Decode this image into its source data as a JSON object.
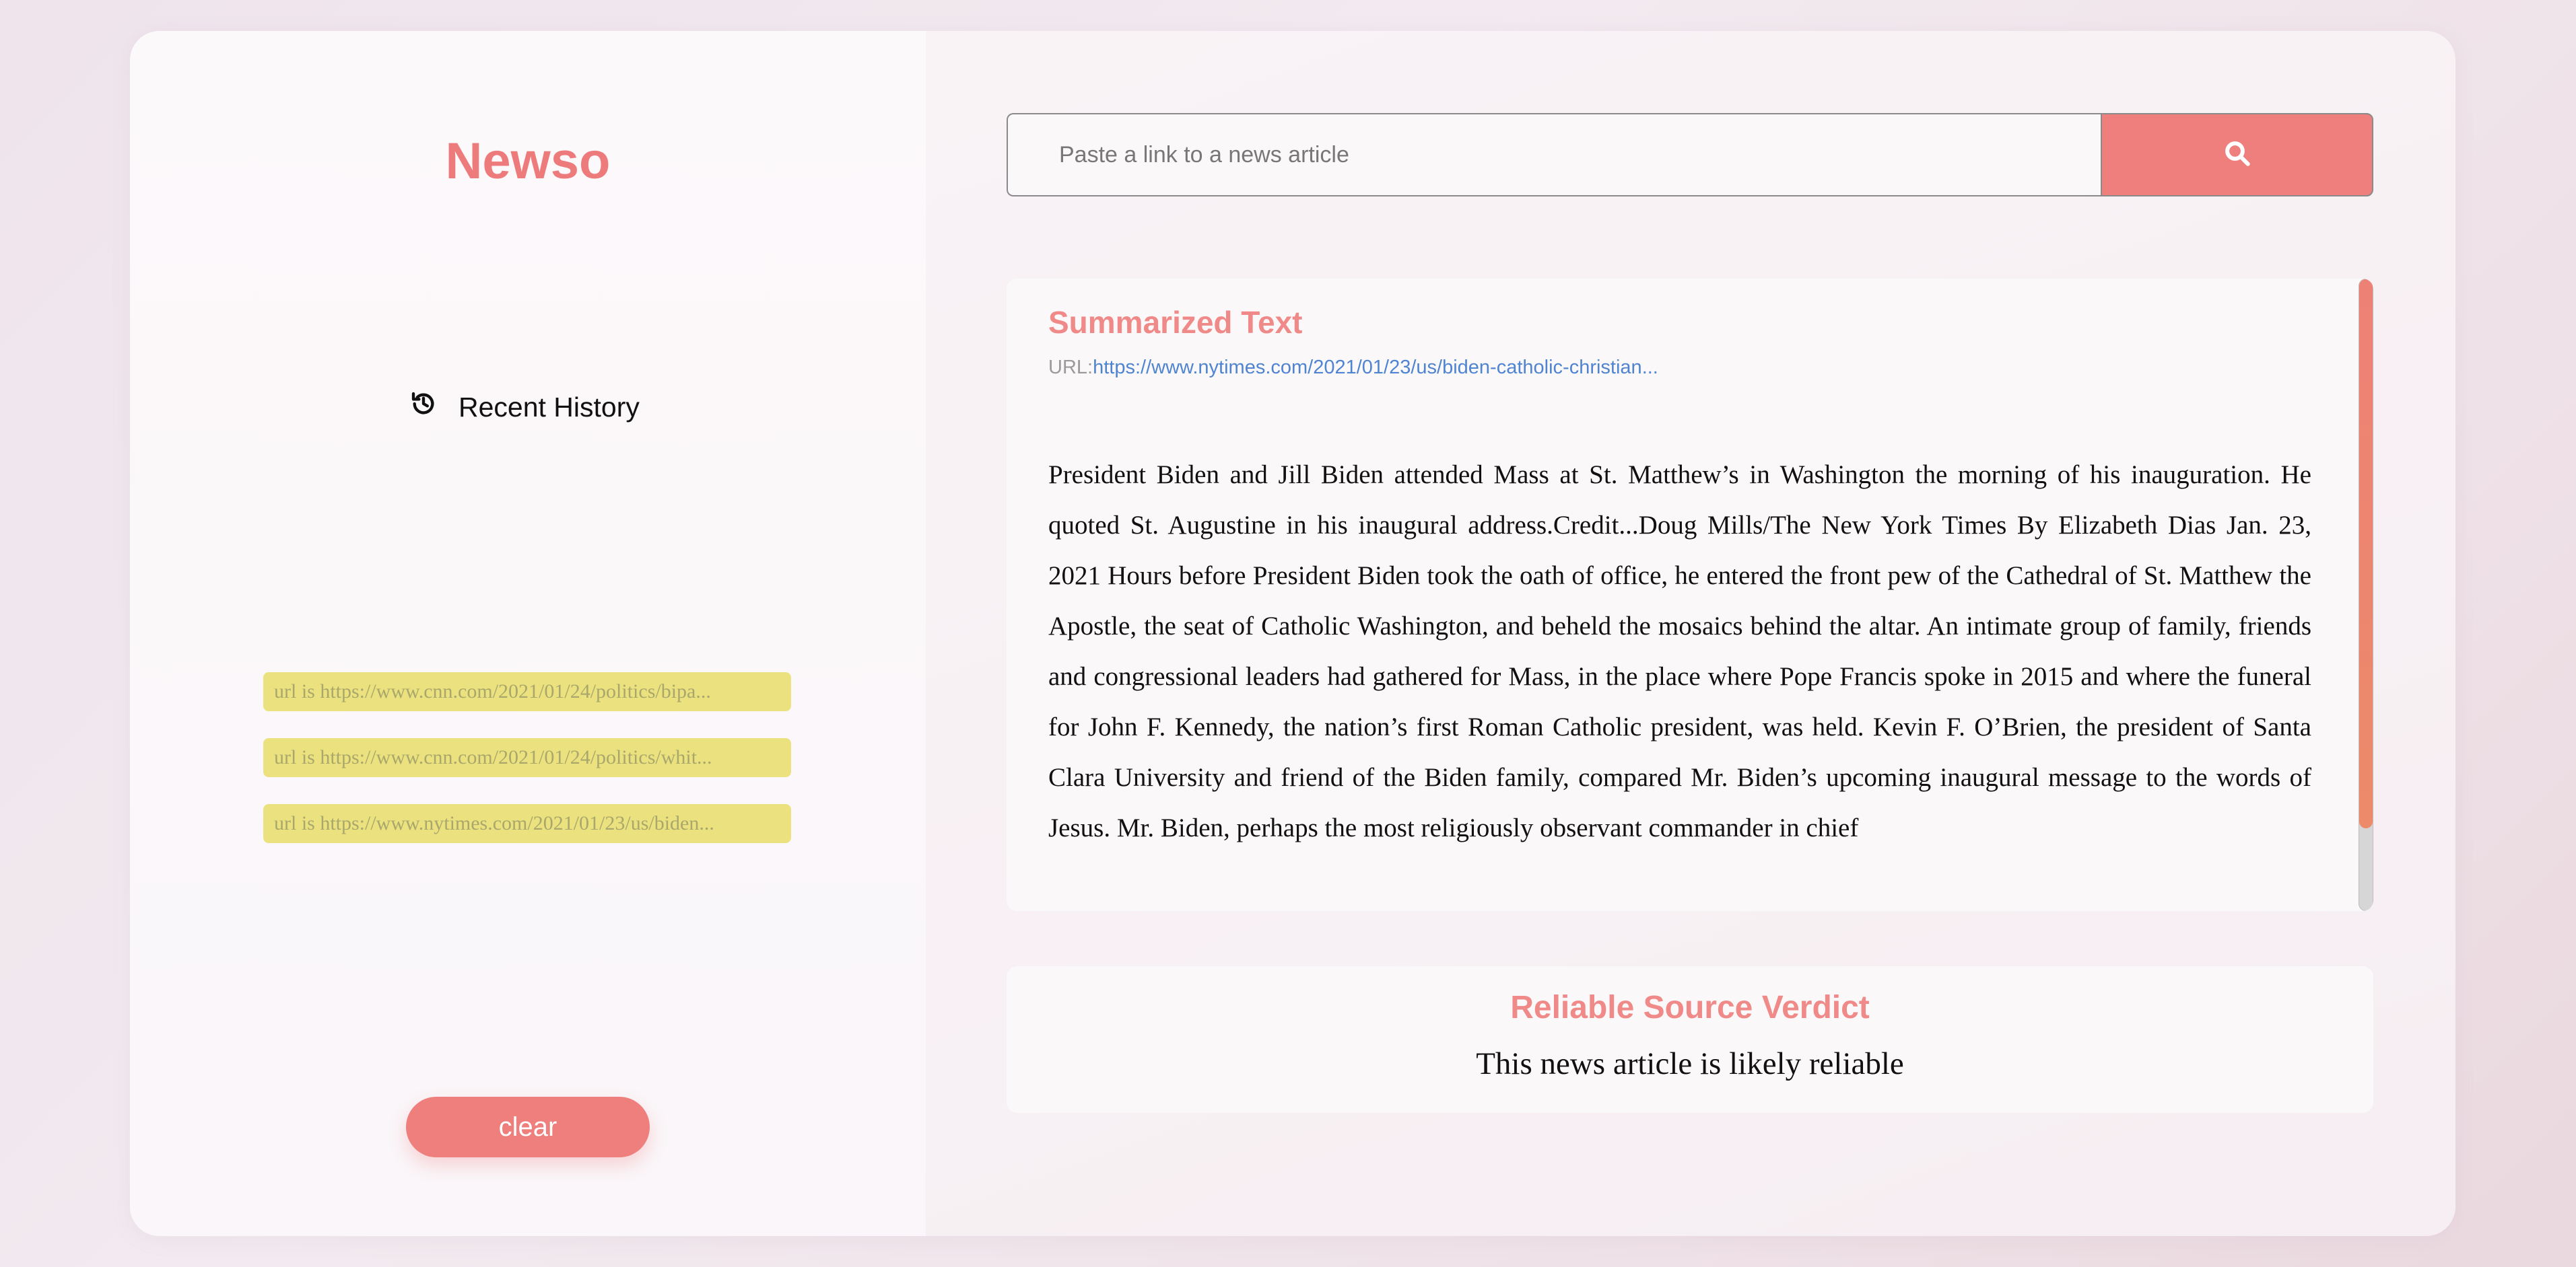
{
  "app": {
    "logo": "Newso"
  },
  "sidebar": {
    "history_title": "Recent History",
    "history_icon": "history-icon",
    "items": [
      {
        "label": "url is https://www.cnn.com/2021/01/24/politics/bipa..."
      },
      {
        "label": "url is https://www.cnn.com/2021/01/24/politics/whit..."
      },
      {
        "label": "url is https://www.nytimes.com/2021/01/23/us/biden..."
      }
    ],
    "clear_label": "clear"
  },
  "search": {
    "placeholder": "Paste a link to a news article",
    "value": "",
    "button_icon": "search-icon"
  },
  "summary": {
    "title": "Summarized Text",
    "url_label": "URL:",
    "url_value": "https://www.nytimes.com/2021/01/23/us/biden-catholic-christian...",
    "text": "President Biden and Jill Biden attended Mass at St. Matthew’s in Washington the morning of his inauguration. He quoted St. Augustine in his inaugural address.Credit...Doug Mills/The New York Times By Elizabeth Dias Jan. 23, 2021 Hours before President Biden took the oath of office, he entered the front pew of the Cathedral of St. Matthew the Apostle, the seat of Catholic Washington, and beheld the mosaics behind the altar. An intimate group of family, friends and congressional leaders had gathered for Mass, in the place where Pope Francis spoke in 2015 and where the funeral for John F. Kennedy, the nation’s first Roman Catholic president, was held. Kevin F. O’Brien, the president of Santa Clara University and friend of the Biden family, compared Mr. Biden’s upcoming inaugural message to the words of Jesus. Mr. Biden, perhaps the most religiously observant commander in chief"
  },
  "verdict": {
    "title": "Reliable Source Verdict",
    "text": "This news article is likely reliable"
  },
  "colors": {
    "accent": "#ee7f7d",
    "history_item_bg": "#ebe27f",
    "link": "#4f84d0"
  }
}
